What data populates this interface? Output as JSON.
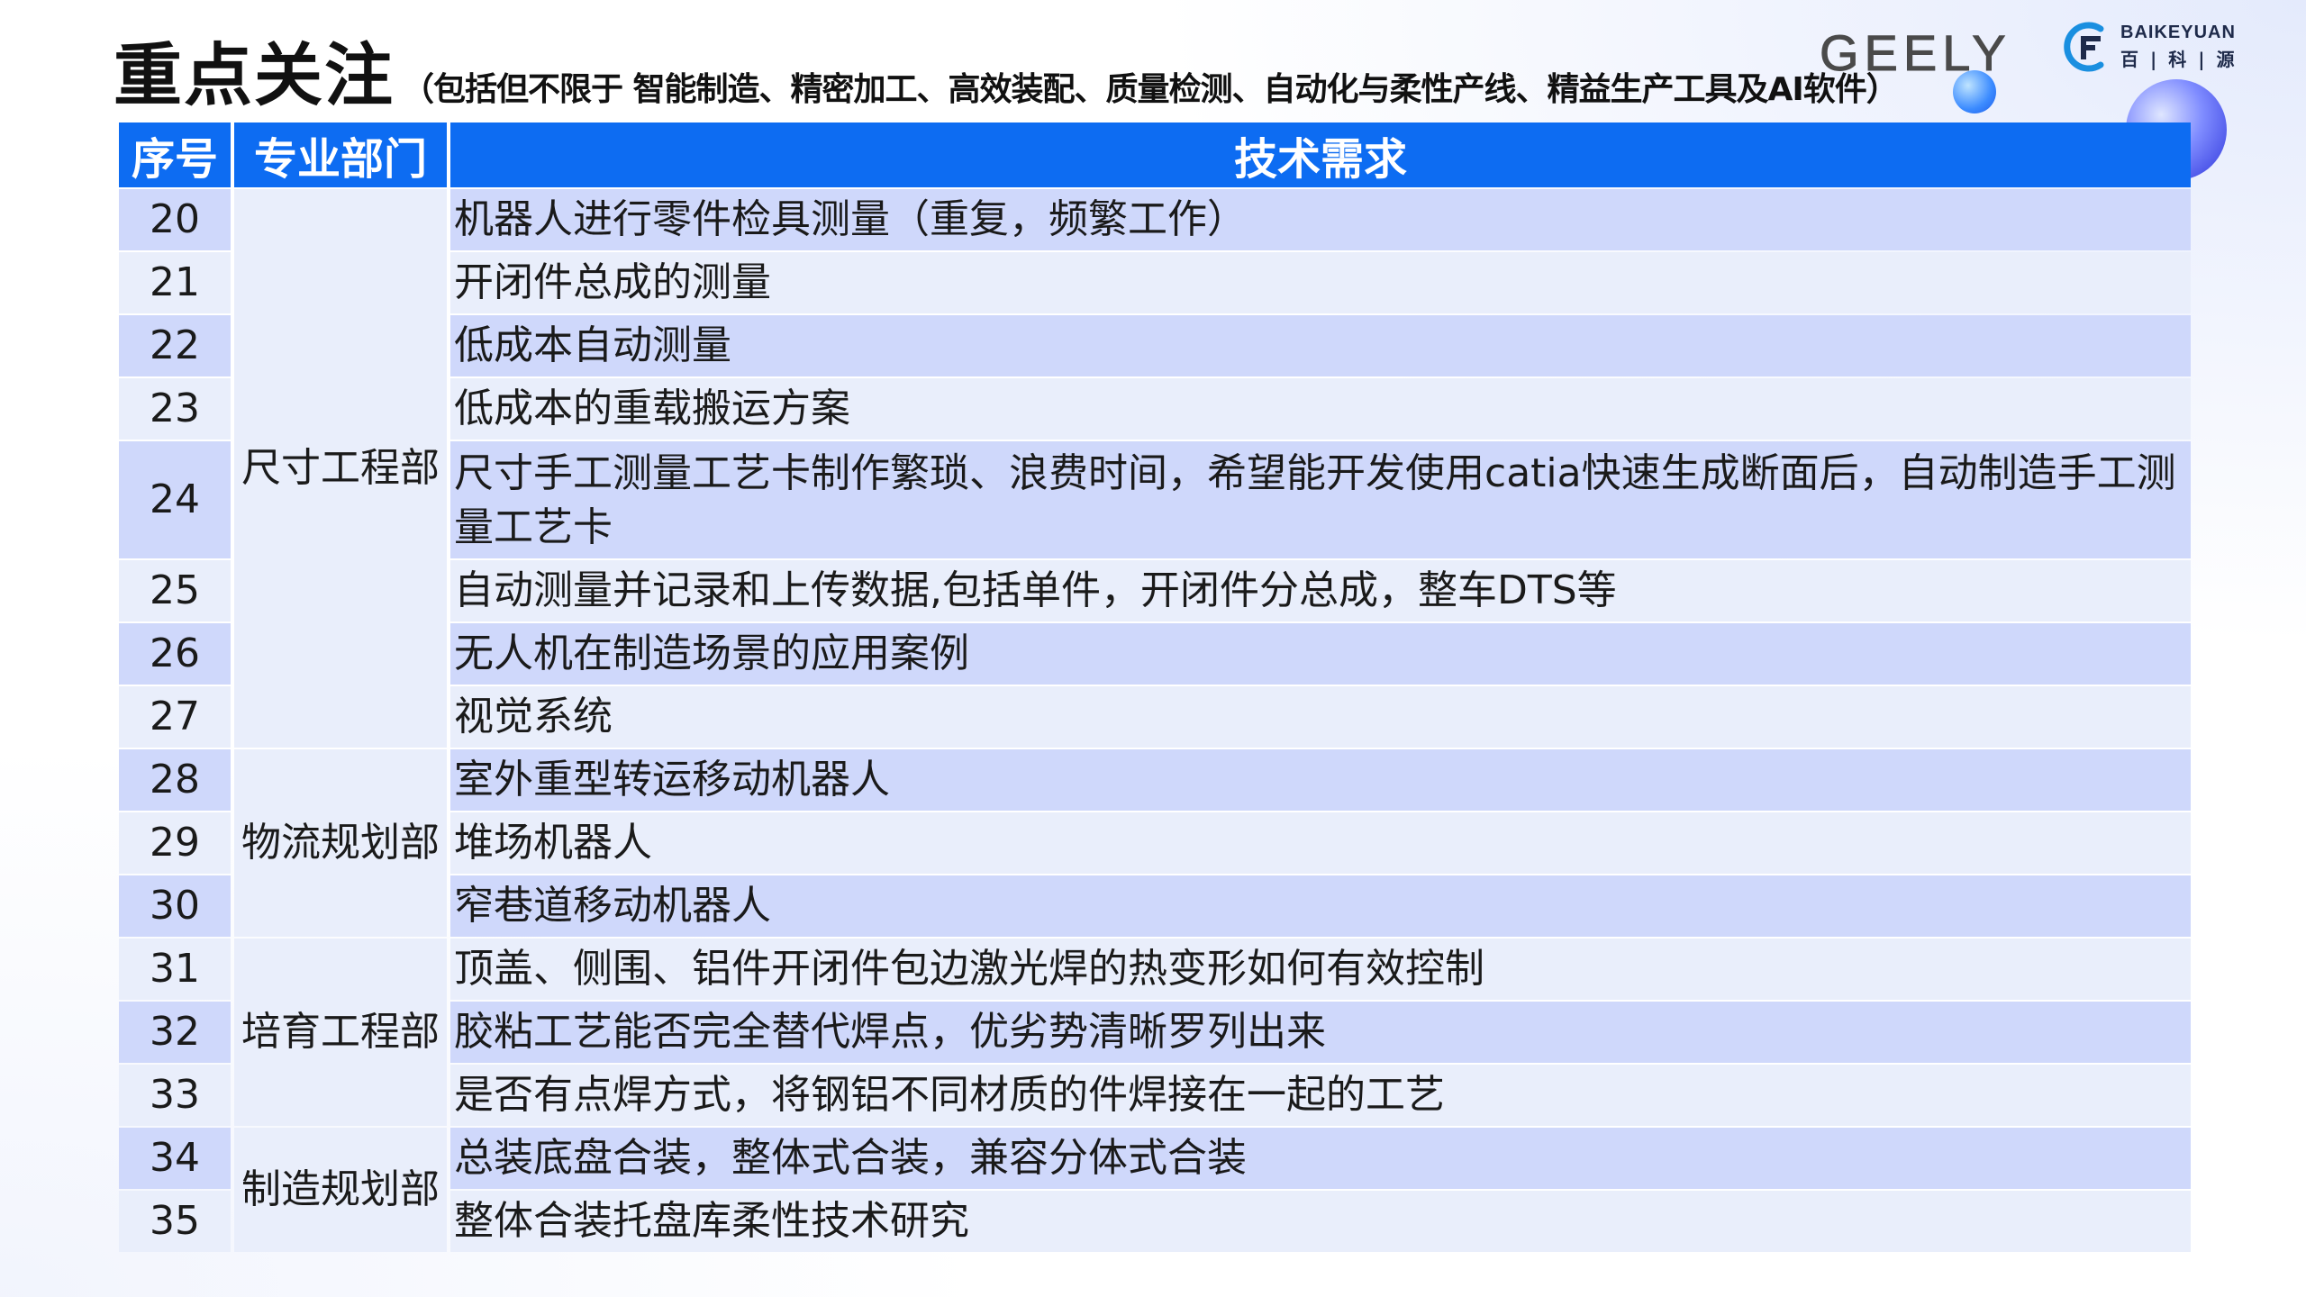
{
  "header": {
    "title": "重点关注",
    "subtitle": "（包括但不限于 智能制造、精密加工、高效装配、质量检测、自动化与柔性产线、精益生产工具及AI软件）"
  },
  "logos": {
    "geely": "GEELY",
    "baikeyuan_en": "BAIKEYUAN",
    "baikeyuan_cn": "百 | 科 | 源"
  },
  "table": {
    "headers": [
      "序号",
      "专业部门",
      "技术需求"
    ],
    "departments": [
      "尺寸工程部",
      "物流规划部",
      "培育工程部",
      "制造规划部"
    ],
    "rows": [
      {
        "no": "20",
        "req": "机器人进行零件检具测量（重复，频繁工作）"
      },
      {
        "no": "21",
        "req": "开闭件总成的测量"
      },
      {
        "no": "22",
        "req": "低成本自动测量"
      },
      {
        "no": "23",
        "req": "低成本的重载搬运方案"
      },
      {
        "no": "24",
        "req": "尺寸手工测量工艺卡制作繁琐、浪费时间，希望能开发使用catia快速生成断面后，自动制造手工测量工艺卡"
      },
      {
        "no": "25",
        "req": "自动测量并记录和上传数据,包括单件，开闭件分总成，整车DTS等"
      },
      {
        "no": "26",
        "req": "无人机在制造场景的应用案例"
      },
      {
        "no": "27",
        "req": "视觉系统"
      },
      {
        "no": "28",
        "req": "室外重型转运移动机器人"
      },
      {
        "no": "29",
        "req": "堆场机器人"
      },
      {
        "no": "30",
        "req": "窄巷道移动机器人"
      },
      {
        "no": "31",
        "req": "顶盖、侧围、铝件开闭件包边激光焊的热变形如何有效控制"
      },
      {
        "no": "32",
        "req": "胶粘工艺能否完全替代焊点，优劣势清晰罗列出来"
      },
      {
        "no": "33",
        "req": "是否有点焊方式，将钢铝不同材质的件焊接在一起的工艺"
      },
      {
        "no": "34",
        "req": "总装底盘合装，整体式合装，兼容分体式合装"
      },
      {
        "no": "35",
        "req": "整体合装托盘库柔性技术研究"
      }
    ]
  },
  "colors": {
    "header_blue": "#0d6cf2",
    "row_dark": "#cfd8fb",
    "row_light": "#e9eefb"
  }
}
